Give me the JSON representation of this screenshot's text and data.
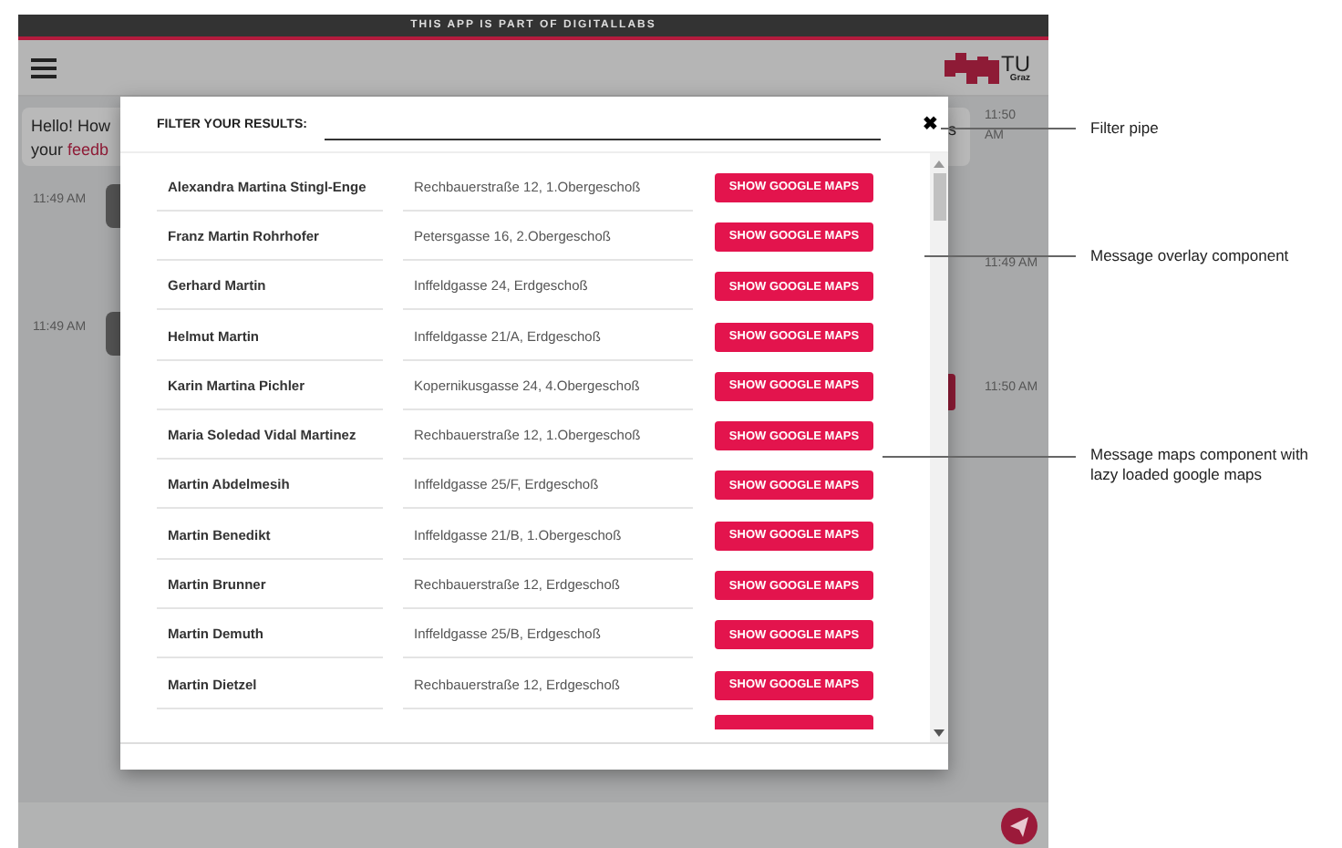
{
  "banner": "THIS APP IS PART OF DIGITALLABS",
  "logo": {
    "text": "TU",
    "subtext": "Graz"
  },
  "chat": {
    "bubble": {
      "line1": "Hello! How",
      "line2": "your",
      "link": "feedb"
    },
    "peek": "s",
    "times": [
      "11:49 AM",
      "11:49 AM",
      "11:50 AM",
      "11:49 AM",
      "11:50 AM"
    ]
  },
  "modal": {
    "filter_label": "FILTER YOUR RESULTS:",
    "close": "✖",
    "rows": [
      {
        "name": "Alexandra Martina Stingl-Enge",
        "address": "Rechbauerstraße 12, 1.Obergeschoß",
        "button": "SHOW GOOGLE MAPS"
      },
      {
        "name": "Franz Martin Rohrhofer",
        "address": "Petersgasse 16, 2.Obergeschoß",
        "button": "SHOW GOOGLE MAPS"
      },
      {
        "name": "Gerhard Martin",
        "address": "Inffeldgasse 24, Erdgeschoß",
        "button": "SHOW GOOGLE MAPS"
      },
      {
        "name": "Helmut Martin",
        "address": "Inffeldgasse 21/A, Erdgeschoß",
        "button": "SHOW GOOGLE MAPS"
      },
      {
        "name": "Karin Martina Pichler",
        "address": "Kopernikusgasse 24, 4.Obergeschoß",
        "button": "SHOW GOOGLE MAPS"
      },
      {
        "name": "Maria Soledad Vidal Martinez",
        "address": "Rechbauerstraße 12, 1.Obergeschoß",
        "button": "SHOW GOOGLE MAPS"
      },
      {
        "name": "Martin Abdelmesih",
        "address": "Inffeldgasse 25/F, Erdgeschoß",
        "button": "SHOW GOOGLE MAPS"
      },
      {
        "name": "Martin Benedikt",
        "address": "Inffeldgasse 21/B, 1.Obergeschoß",
        "button": "SHOW GOOGLE MAPS"
      },
      {
        "name": "Martin Brunner",
        "address": "Rechbauerstraße 12, Erdgeschoß",
        "button": "SHOW GOOGLE MAPS"
      },
      {
        "name": "Martin Demuth",
        "address": "Inffeldgasse 25/B, Erdgeschoß",
        "button": "SHOW GOOGLE MAPS"
      },
      {
        "name": "Martin Dietzel",
        "address": "Rechbauerstraße 12, Erdgeschoß",
        "button": "SHOW GOOGLE MAPS"
      }
    ]
  },
  "annotations": [
    "Filter pipe",
    "Message overlay component",
    "Message maps component with lazy loaded google maps"
  ]
}
